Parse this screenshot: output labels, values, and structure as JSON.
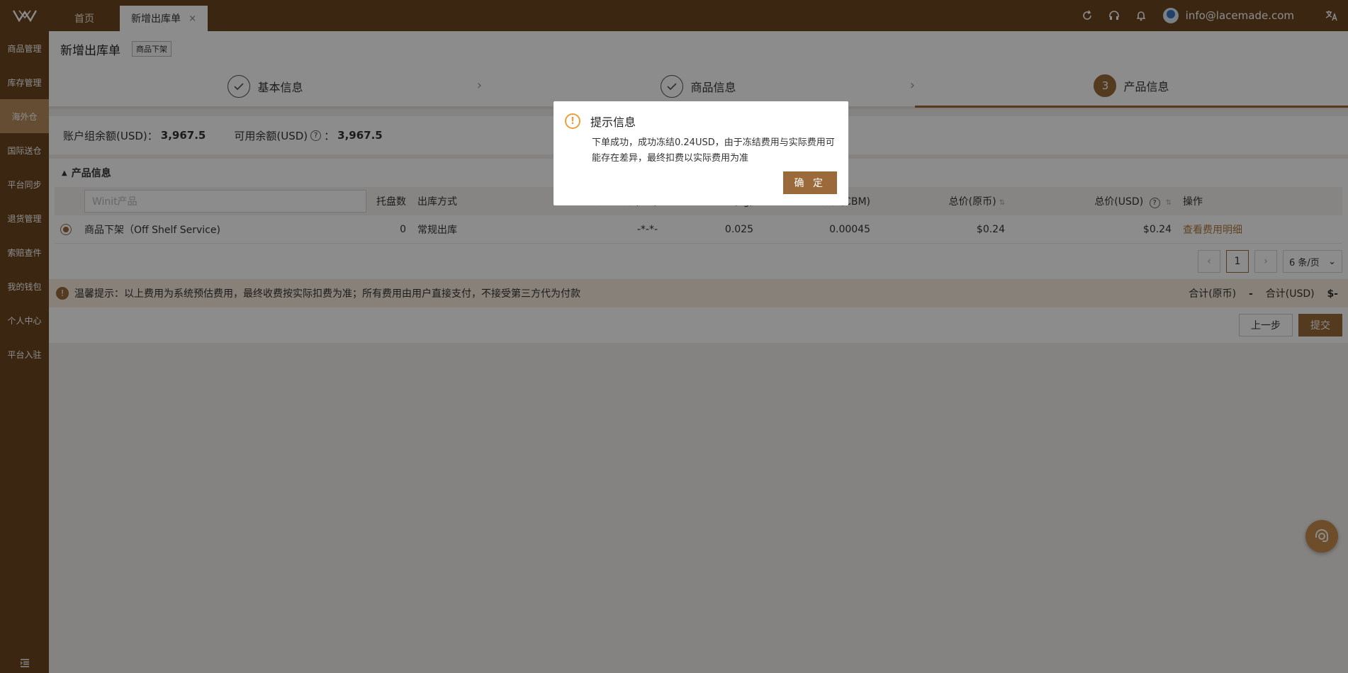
{
  "topbar": {
    "tabs": [
      {
        "label": "首页"
      },
      {
        "label": "新增出库单",
        "close": "×"
      }
    ],
    "user_email": "info@lacemade.com",
    "icons": [
      "refresh-icon",
      "headset-icon",
      "bell-icon",
      "translate-icon"
    ]
  },
  "sidebar": {
    "items": [
      {
        "label": "商品管理"
      },
      {
        "label": "库存管理"
      },
      {
        "label": "海外仓"
      },
      {
        "label": "国际送仓"
      },
      {
        "label": "平台同步"
      },
      {
        "label": "退货管理"
      },
      {
        "label": "索赔查件"
      },
      {
        "label": "我的钱包"
      },
      {
        "label": "个人中心"
      },
      {
        "label": "平台入驻"
      }
    ],
    "active_index": 2
  },
  "page": {
    "title": "新增出库单",
    "tag": "商品下架"
  },
  "steps": [
    {
      "label": "基本信息",
      "state": "done"
    },
    {
      "label": "商品信息",
      "state": "done"
    },
    {
      "label": "产品信息",
      "state": "current",
      "number": "3"
    }
  ],
  "balance": {
    "group_label": "账户组余额(USD)：",
    "group_value": "3,967.5",
    "available_label": "可用余额(USD)",
    "available_suffix": "：",
    "available_value": "3,967.5"
  },
  "section": {
    "title": "产品信息"
  },
  "table": {
    "search_placeholder": "Winit产品",
    "headers": {
      "pallets": "托盘数",
      "method": "出库方式",
      "size": "打包尺寸(cm)",
      "weight": "重量(kg)",
      "volume": "体积(CBM)",
      "total": "总价(原币)",
      "total_usd": "总价(USD)",
      "action": "操作"
    },
    "rows": [
      {
        "product": "商品下架（Off Shelf Service)",
        "pallets": "0",
        "method": "常规出库",
        "size": "-*-*-",
        "weight": "0.025",
        "volume": "0.00045",
        "total": "$0.24",
        "total_usd": "$0.24",
        "action": "查看费用明细"
      }
    ]
  },
  "pager": {
    "current": "1",
    "page_size": "6 条/页"
  },
  "notice": {
    "text": "温馨提示：以上费用为系统预估费用，最终收费按实际扣费为准；所有费用由用户直接支付，不接受第三方代为付款",
    "sum_label": "合计(原币)",
    "sum_value": "-",
    "sum_usd_label": "合计(USD)",
    "sum_usd_value": "$-"
  },
  "actions": {
    "prev": "上一步",
    "submit": "提交"
  },
  "modal": {
    "title": "提示信息",
    "body": "下单成功，成功冻结0.24USD，由于冻结费用与实际费用可能存在差异，最终扣费以实际费用为准",
    "ok": "确 定"
  },
  "colors": {
    "brand": "#6b4520",
    "accent": "#9a6a3a",
    "warning": "#e6a23c"
  }
}
